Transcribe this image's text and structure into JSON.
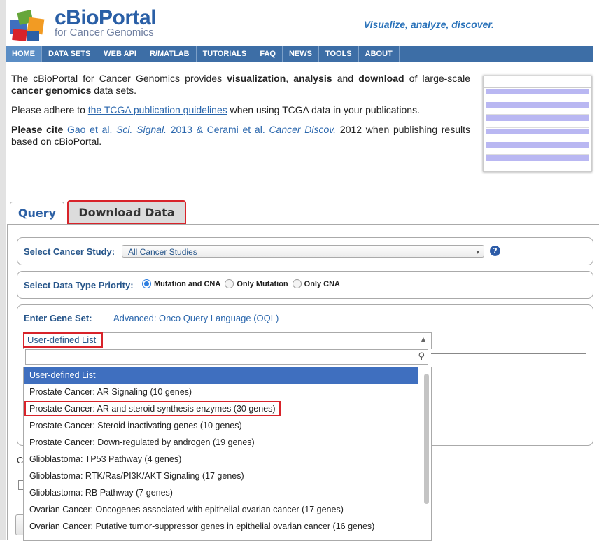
{
  "header": {
    "brand_main": "cBioPortal",
    "brand_sub": "for Cancer Genomics",
    "tagline": "Visualize, analyze, discover."
  },
  "nav": {
    "items": [
      "HOME",
      "DATA SETS",
      "WEB API",
      "R/MATLAB",
      "TUTORIALS",
      "FAQ",
      "NEWS",
      "TOOLS",
      "ABOUT"
    ],
    "active": "HOME"
  },
  "intro": {
    "p1_a": "The cBioPortal for Cancer Genomics provides ",
    "p1_b": "visualization",
    "p1_c": ", ",
    "p1_d": "analysis",
    "p1_e": " and ",
    "p1_f": "download",
    "p1_g": " of large-scale ",
    "p1_h": "cancer genomics",
    "p1_i": " data sets.",
    "p2_a": "Please adhere to ",
    "p2_link": "the TCGA publication guidelines",
    "p2_b": " when using TCGA data in your publications.",
    "p3_a": "Please cite",
    "p3_b": " Gao et al. ",
    "p3_c": "Sci. Signal.",
    "p3_d": " 2013 & Cerami et al. ",
    "p3_e": "Cancer Discov.",
    "p3_f": " 2012 when publishing results based on cBioPortal."
  },
  "tabs": {
    "query": "Query",
    "download": "Download Data"
  },
  "form": {
    "study_label": "Select Cancer Study:",
    "study_value": "All Cancer Studies",
    "dtype_label": "Select Data Type Priority:",
    "dtype_options": [
      "Mutation and CNA",
      "Only Mutation",
      "Only CNA"
    ],
    "dtype_selected": "Mutation and CNA",
    "gene_label": "Enter Gene Set:",
    "oql_link": "Advanced: Onco Query Language (OQL)",
    "gene_set_value": "User-defined List",
    "search_value": "",
    "options": [
      "User-defined List",
      "Prostate Cancer: AR Signaling (10 genes)",
      "Prostate Cancer: AR and steroid synthesis enzymes (30 genes)",
      "Prostate Cancer: Steroid inactivating genes (10 genes)",
      "Prostate Cancer: Down-regulated by androgen (19 genes)",
      "Glioblastoma: TP53 Pathway (4 genes)",
      "Glioblastoma: RTK/Ras/PI3K/AKT Signaling (17 genes)",
      "Glioblastoma: RB Pathway (7 genes)",
      "Ovarian Cancer: Oncogenes associated with epithelial ovarian cancer (17 genes)",
      "Ovarian Cancer: Putative tumor-suppressor genes in epithelial ovarian cancer (16 genes)"
    ],
    "highlighted_index": 0,
    "boxed_index": 2
  },
  "colors": {
    "nav_bg": "#3d6ea6",
    "brand": "#2a5fa6",
    "highlight": "#d8232a",
    "selected_option": "#3f6fbf"
  },
  "icons": {
    "help": "question-icon",
    "search": "magnifier-icon",
    "caret_up": "triangle-up-icon",
    "caret_down": "triangle-down-icon"
  }
}
